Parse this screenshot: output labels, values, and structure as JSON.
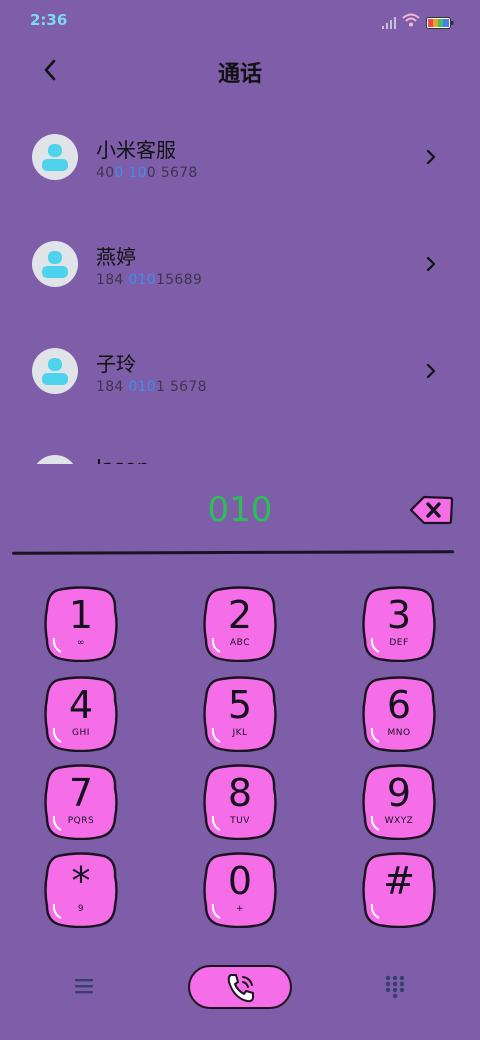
{
  "status": {
    "time": "2:36"
  },
  "header": {
    "title": "通话"
  },
  "contacts": [
    {
      "name": "小米客服",
      "num_pre": "40",
      "num_hl": "0 10",
      "num_post": "0 5678"
    },
    {
      "name": "燕婷",
      "num_pre": "184 ",
      "num_hl": "010",
      "num_post": "15689"
    },
    {
      "name": "子玲",
      "num_pre": "184 ",
      "num_hl": "010",
      "num_post": "1 5678"
    },
    {
      "name": "Jason",
      "num_pre": "",
      "num_hl": "",
      "num_post": ""
    }
  ],
  "dialer": {
    "number": "010"
  },
  "keypad": [
    {
      "digit": "1",
      "letters": "∞"
    },
    {
      "digit": "2",
      "letters": "ABC"
    },
    {
      "digit": "3",
      "letters": "DEF"
    },
    {
      "digit": "4",
      "letters": "GHI"
    },
    {
      "digit": "5",
      "letters": "JKL"
    },
    {
      "digit": "6",
      "letters": "MNO"
    },
    {
      "digit": "7",
      "letters": "PQRS"
    },
    {
      "digit": "8",
      "letters": "TUV"
    },
    {
      "digit": "9",
      "letters": "WXYZ"
    },
    {
      "digit": "*",
      "letters": "9"
    },
    {
      "digit": "0",
      "letters": "+"
    },
    {
      "digit": "#",
      "letters": ""
    }
  ],
  "colors": {
    "background": "#7e5ea8",
    "key_fill": "#f56ee8",
    "dial_number": "#2dbe5a",
    "highlight": "#3d8df0",
    "time": "#7fd9ef"
  },
  "icons": {
    "back": "back-arrow-icon",
    "delete": "backspace-icon",
    "call": "phone-icon",
    "menu": "hamburger-icon",
    "keypad": "dialpad-icon"
  }
}
